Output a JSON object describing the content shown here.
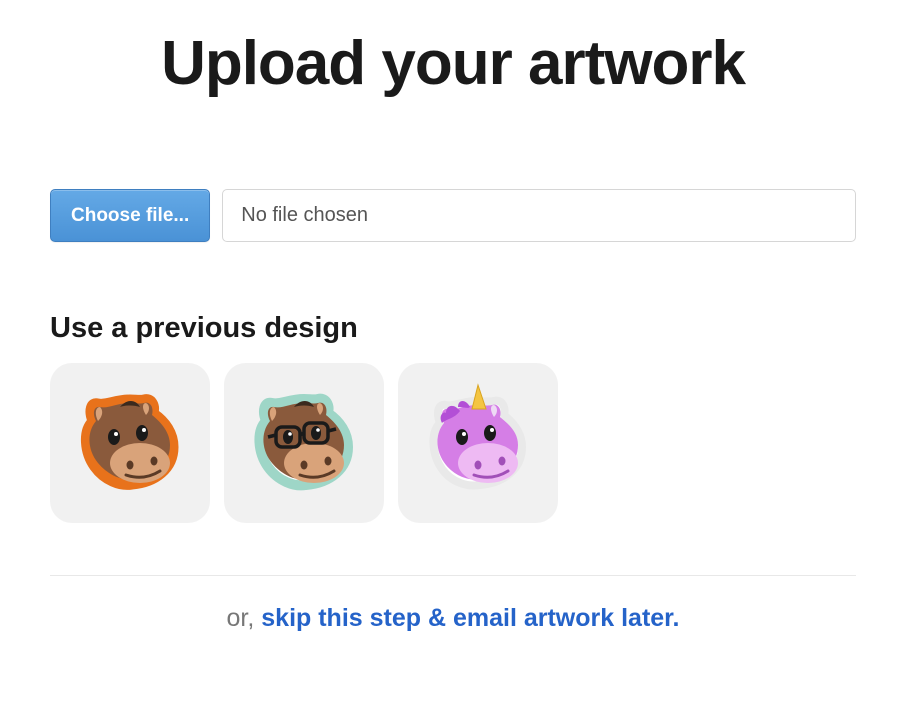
{
  "title": "Upload your artwork",
  "uploader": {
    "choose_label": "Choose file...",
    "file_status": "No file chosen"
  },
  "previous": {
    "heading": "Use a previous design",
    "designs": [
      {
        "name": "donkey-orange"
      },
      {
        "name": "donkey-glasses-teal"
      },
      {
        "name": "unicorn-pink"
      }
    ]
  },
  "skip": {
    "prefix": "or, ",
    "link_text": "skip this step & email artwork later."
  }
}
